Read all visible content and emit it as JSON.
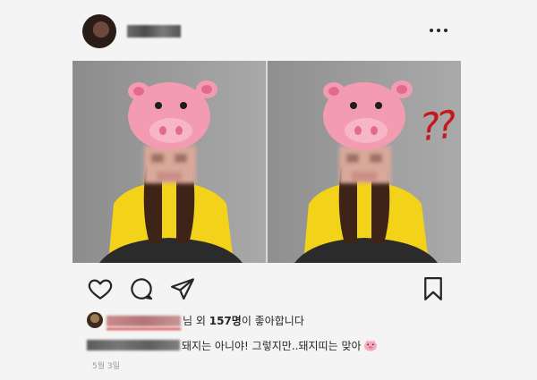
{
  "post": {
    "likes": {
      "suffix_honorific": "님 외 ",
      "count": "157명",
      "suffix": "이 좋아합니다"
    },
    "caption": {
      "text": "돼지는 아니야! 그렇지만..돼지띠는 맞아"
    },
    "timestamp": "5월 3일"
  },
  "annotation": {
    "text": "??",
    "color": "#c51818"
  },
  "icons": [
    "more-icon",
    "heart-icon",
    "comment-icon",
    "share-icon",
    "bookmark-icon",
    "pig-emoji-icon"
  ]
}
